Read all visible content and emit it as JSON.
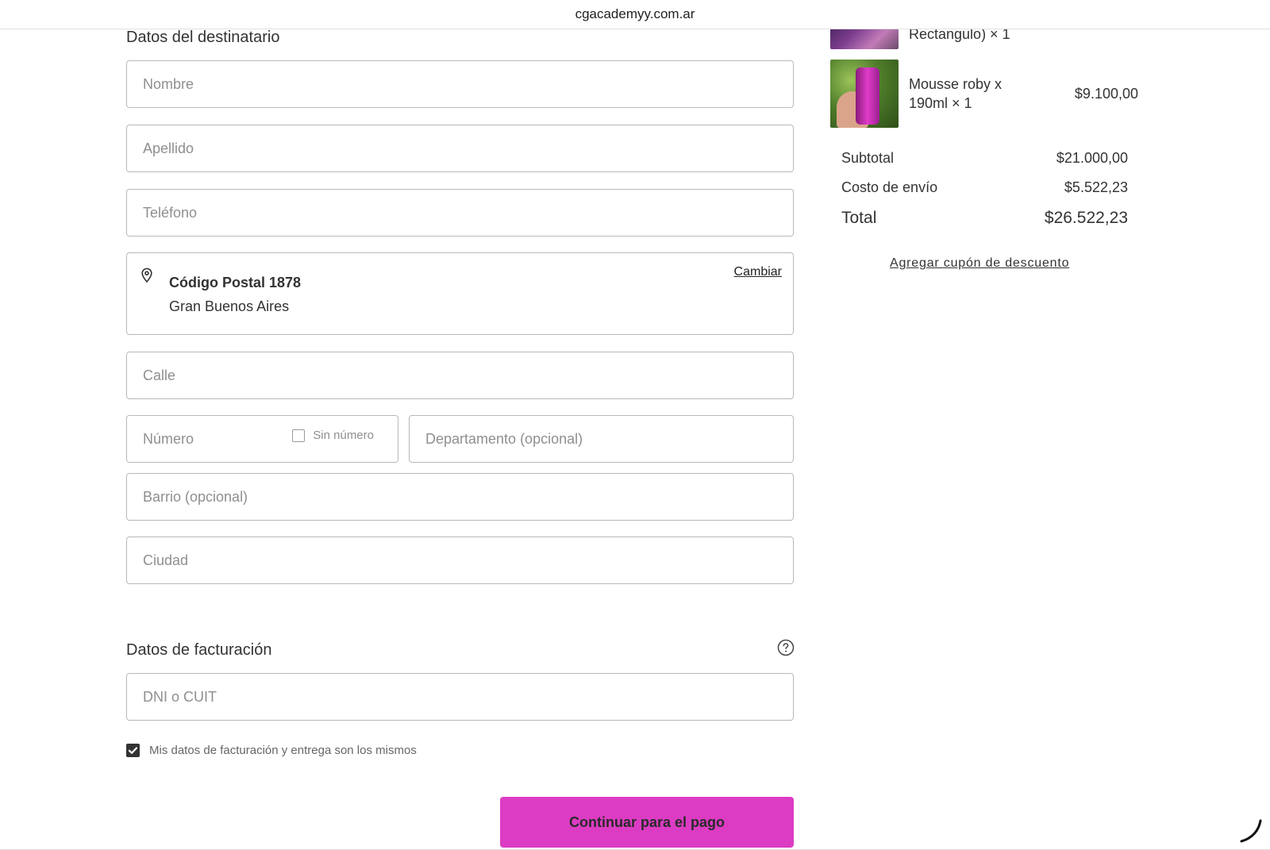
{
  "browser": {
    "url": "cgacademyy.com.ar"
  },
  "shipping": {
    "title": "Datos del destinatario",
    "fields": {
      "nombre": "Nombre",
      "apellido": "Apellido",
      "telefono": "Teléfono",
      "calle": "Calle",
      "numero": "Número",
      "sin_numero": "Sin número",
      "departamento": "Departamento (opcional)",
      "barrio": "Barrio (opcional)",
      "ciudad": "Ciudad"
    },
    "postal": {
      "title": "Código Postal 1878",
      "region": "Gran Buenos Aires",
      "change": "Cambiar"
    }
  },
  "billing": {
    "title": "Datos de facturación",
    "dni_placeholder": "DNI o CUIT",
    "same_data_label": "Mis datos de facturación y entrega son los mismos",
    "same_data_checked": true
  },
  "continue_button": "Continuar para el pago",
  "cart": {
    "items": [
      {
        "name_line1": "Rectangulo) × 1",
        "name_line2": "",
        "price": ""
      },
      {
        "name_line1": "Mousse roby x",
        "name_line2": "190ml × 1",
        "price": "$9.100,00"
      }
    ],
    "subtotal_label": "Subtotal",
    "subtotal_value": "$21.000,00",
    "shipping_label": "Costo de envío",
    "shipping_value": "$5.522,23",
    "total_label": "Total",
    "total_value": "$26.522,23",
    "coupon_link": "Agregar cupón de descuento"
  },
  "colors": {
    "accent": "#dc3cc3",
    "border": "#b9b9b9"
  }
}
